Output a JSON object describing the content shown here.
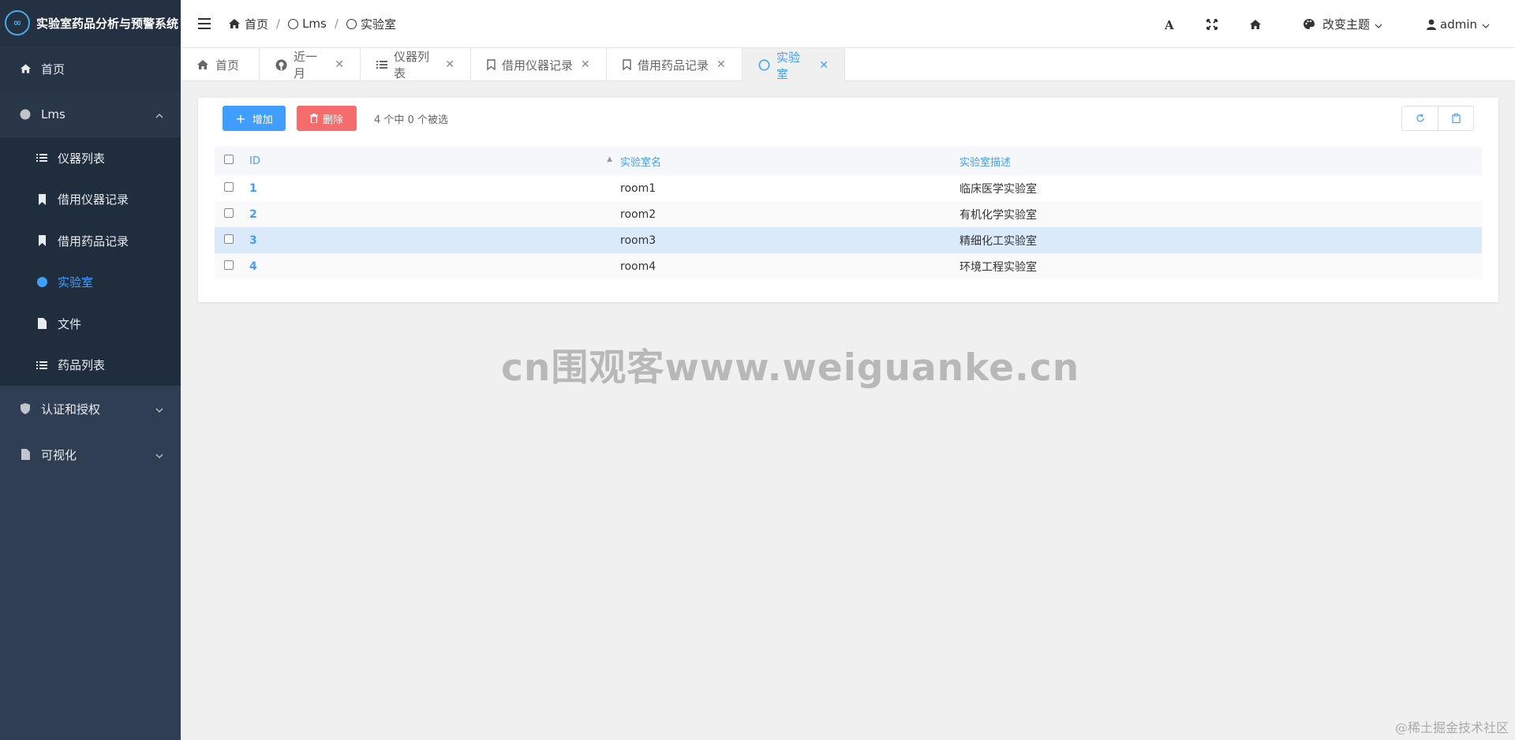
{
  "app": {
    "title": "实验室药品分析与预警系统",
    "logo_text": "∞",
    "accent_color": "#409eff"
  },
  "sidebar": {
    "items": [
      {
        "label": "首页",
        "icon": "home-icon"
      },
      {
        "label": "Lms",
        "icon": "circle-icon",
        "expanded": true
      },
      {
        "label": "认证和授权",
        "icon": "shield-icon",
        "expanded": false
      },
      {
        "label": "可视化",
        "icon": "file-icon",
        "expanded": false
      }
    ],
    "lms_children": [
      {
        "label": "仪器列表",
        "icon": "list-icon"
      },
      {
        "label": "借用仪器记录",
        "icon": "bookmark-icon"
      },
      {
        "label": "借用药品记录",
        "icon": "bookmark-icon"
      },
      {
        "label": "实验室",
        "icon": "dot-icon",
        "active": true
      },
      {
        "label": "文件",
        "icon": "file-icon"
      },
      {
        "label": "药品列表",
        "icon": "list-icon"
      }
    ]
  },
  "header": {
    "breadcrumb": [
      "首页",
      "Lms",
      "实验室"
    ],
    "theme_label": "改变主题",
    "user_label": "admin"
  },
  "tabs": [
    {
      "label": "首页",
      "closable": false
    },
    {
      "label": "近一月",
      "closable": true
    },
    {
      "label": "仪器列表",
      "closable": true
    },
    {
      "label": "借用仪器记录",
      "closable": true
    },
    {
      "label": "借用药品记录",
      "closable": true
    },
    {
      "label": "实验室",
      "closable": true,
      "active": true
    }
  ],
  "toolbar": {
    "add_label": "增加",
    "delete_label": "删除",
    "selection_text": "4 个中 0 个被选"
  },
  "table": {
    "columns": [
      "ID",
      "实验室名",
      "实验室描述"
    ],
    "rows": [
      {
        "id": "1",
        "name": "room1",
        "desc": "临床医学实验室"
      },
      {
        "id": "2",
        "name": "room2",
        "desc": "有机化学实验室"
      },
      {
        "id": "3",
        "name": "room3",
        "desc": "精细化工实验室"
      },
      {
        "id": "4",
        "name": "room4",
        "desc": "环境工程实验室"
      }
    ]
  },
  "watermark": "cn围观客www.weiguanke.cn",
  "footer_mark": "@稀土掘金技术社区"
}
